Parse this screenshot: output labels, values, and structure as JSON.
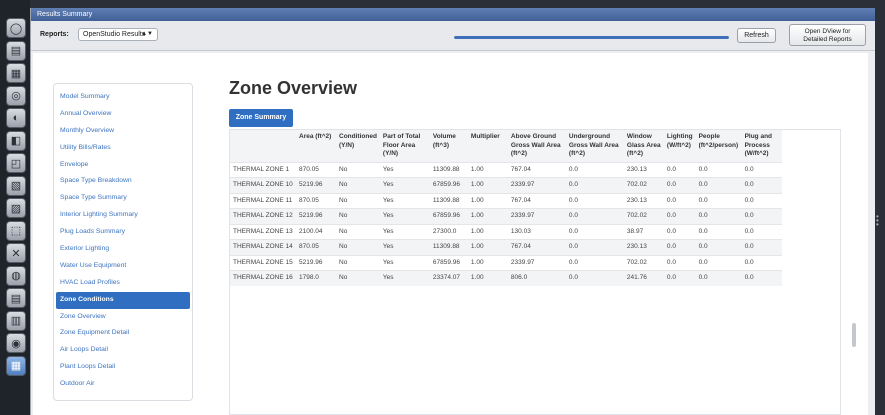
{
  "window": {
    "title": "Results Summary"
  },
  "toolbar": {
    "reports_label": "Reports:",
    "reports_value": "OpenStudio Results",
    "progress": 1.0,
    "refresh_label": "Refresh",
    "dview_line1": "Open DView for",
    "dview_line2": "Detailed Reports"
  },
  "tools": [
    "building-icon",
    "site-icon",
    "schedules-icon",
    "constructions-icon",
    "loads-icon",
    "space-types-icon",
    "geometry-icon",
    "facility-icon",
    "spaces-icon",
    "thermal-zones-icon",
    "hvac-icon",
    "output-variables-icon",
    "simulation-settings-icon",
    "scripts-icon",
    "run-icon",
    "results-icon"
  ],
  "sidebar": {
    "items": [
      "Model Summary",
      "Annual Overview",
      "Monthly Overview",
      "Utility Bills/Rates",
      "Envelope",
      "Space Type Breakdown",
      "Space Type Summary",
      "Interior Lighting Summary",
      "Plug Loads Summary",
      "Exterior Lighting",
      "Water Use Equipment",
      "HVAC Load Profiles",
      "Zone Conditions",
      "Zone Overview",
      "Zone Equipment Detail",
      "Air Loops Detail",
      "Plant Loops Detail",
      "Outdoor Air"
    ],
    "active_index": 12
  },
  "main": {
    "title": "Zone Overview",
    "tab_label": "Zone Summary"
  },
  "table": {
    "headers": [
      "",
      "Area (ft^2)",
      "Conditioned (Y/N)",
      "Part of Total Floor Area (Y/N)",
      "Volume (ft^3)",
      "Multiplier",
      "Above Ground Gross Wall Area (ft^2)",
      "Underground Gross Wall Area (ft^2)",
      "Window Glass Area (ft^2)",
      "Lighting (W/ft^2)",
      "People (ft^2/person)",
      "Plug and Process (W/ft^2)"
    ],
    "rows": [
      [
        "THERMAL ZONE 1",
        "870.05",
        "No",
        "Yes",
        "11309.88",
        "1.00",
        "767.04",
        "0.0",
        "230.13",
        "0.0",
        "0.0",
        "0.0"
      ],
      [
        "THERMAL ZONE 10",
        "5219.96",
        "No",
        "Yes",
        "67859.96",
        "1.00",
        "2339.97",
        "0.0",
        "702.02",
        "0.0",
        "0.0",
        "0.0"
      ],
      [
        "THERMAL ZONE 11",
        "870.05",
        "No",
        "Yes",
        "11309.88",
        "1.00",
        "767.04",
        "0.0",
        "230.13",
        "0.0",
        "0.0",
        "0.0"
      ],
      [
        "THERMAL ZONE 12",
        "5219.96",
        "No",
        "Yes",
        "67859.96",
        "1.00",
        "2339.97",
        "0.0",
        "702.02",
        "0.0",
        "0.0",
        "0.0"
      ],
      [
        "THERMAL ZONE 13",
        "2100.04",
        "No",
        "Yes",
        "27300.0",
        "1.00",
        "130.03",
        "0.0",
        "38.97",
        "0.0",
        "0.0",
        "0.0"
      ],
      [
        "THERMAL ZONE 14",
        "870.05",
        "No",
        "Yes",
        "11309.88",
        "1.00",
        "767.04",
        "0.0",
        "230.13",
        "0.0",
        "0.0",
        "0.0"
      ],
      [
        "THERMAL ZONE 15",
        "5219.96",
        "No",
        "Yes",
        "67859.96",
        "1.00",
        "2339.97",
        "0.0",
        "702.02",
        "0.0",
        "0.0",
        "0.0"
      ],
      [
        "THERMAL ZONE 16",
        "1798.0",
        "No",
        "Yes",
        "23374.07",
        "1.00",
        "806.0",
        "0.0",
        "241.76",
        "0.0",
        "0.0",
        "0.0"
      ]
    ]
  }
}
